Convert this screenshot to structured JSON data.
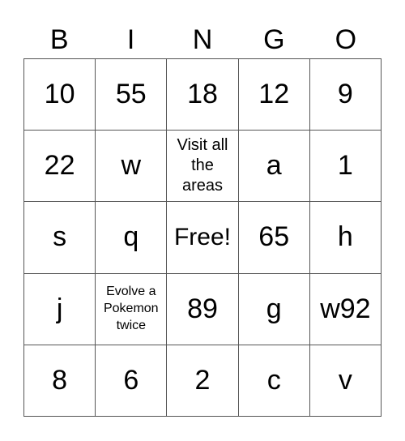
{
  "header": [
    "B",
    "I",
    "N",
    "G",
    "O"
  ],
  "cells": [
    [
      "10",
      "55",
      "18",
      "12",
      "9"
    ],
    [
      "22",
      "w",
      "Visit all the areas",
      "a",
      "1"
    ],
    [
      "s",
      "q",
      "Free!",
      "65",
      "h"
    ],
    [
      "j",
      "Evolve a Pokemon twice",
      "89",
      "g",
      "w92"
    ],
    [
      "8",
      "6",
      "2",
      "c",
      "v"
    ]
  ]
}
